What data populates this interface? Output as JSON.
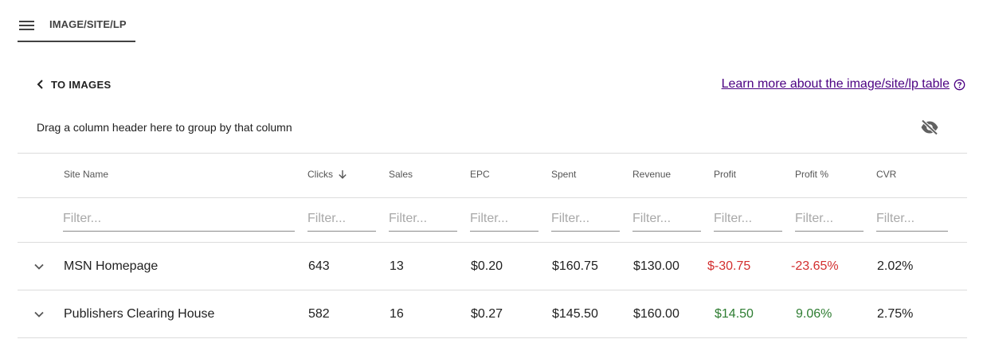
{
  "tab": {
    "label": "IMAGE/SITE/LP"
  },
  "back_link": {
    "label": "TO IMAGES"
  },
  "learn_more": {
    "label": "Learn more about the image/site/lp table"
  },
  "group_hint": "Drag a column header here to group by that column",
  "icons": {
    "menu": "menu-icon",
    "back": "chevron-left-icon",
    "help": "help-circle-icon",
    "visibility": "eye-off-icon",
    "sort": "arrow-down-icon",
    "expand": "chevron-down-icon"
  },
  "colors": {
    "link": "#4b0082",
    "negative": "#d32f2f",
    "positive": "#2e7d32"
  },
  "table": {
    "columns": [
      {
        "label": "Site Name"
      },
      {
        "label": "Clicks",
        "sorted": "descending"
      },
      {
        "label": "Sales"
      },
      {
        "label": "EPC"
      },
      {
        "label": "Spent"
      },
      {
        "label": "Revenue"
      },
      {
        "label": "Profit"
      },
      {
        "label": "Profit %"
      },
      {
        "label": "CVR"
      }
    ],
    "filter_placeholder": "Filter...",
    "rows": [
      {
        "site": "MSN Homepage",
        "clicks": "643",
        "sales": "13",
        "epc": "$0.20",
        "spent": "$160.75",
        "revenue": "$130.00",
        "profit": "$-30.75",
        "profit_pct": "-23.65%",
        "cvr": "2.02%"
      },
      {
        "site": "Publishers Clearing House",
        "clicks": "582",
        "sales": "16",
        "epc": "$0.27",
        "spent": "$145.50",
        "revenue": "$160.00",
        "profit": "$14.50",
        "profit_pct": "9.06%",
        "cvr": "2.75%"
      }
    ]
  }
}
